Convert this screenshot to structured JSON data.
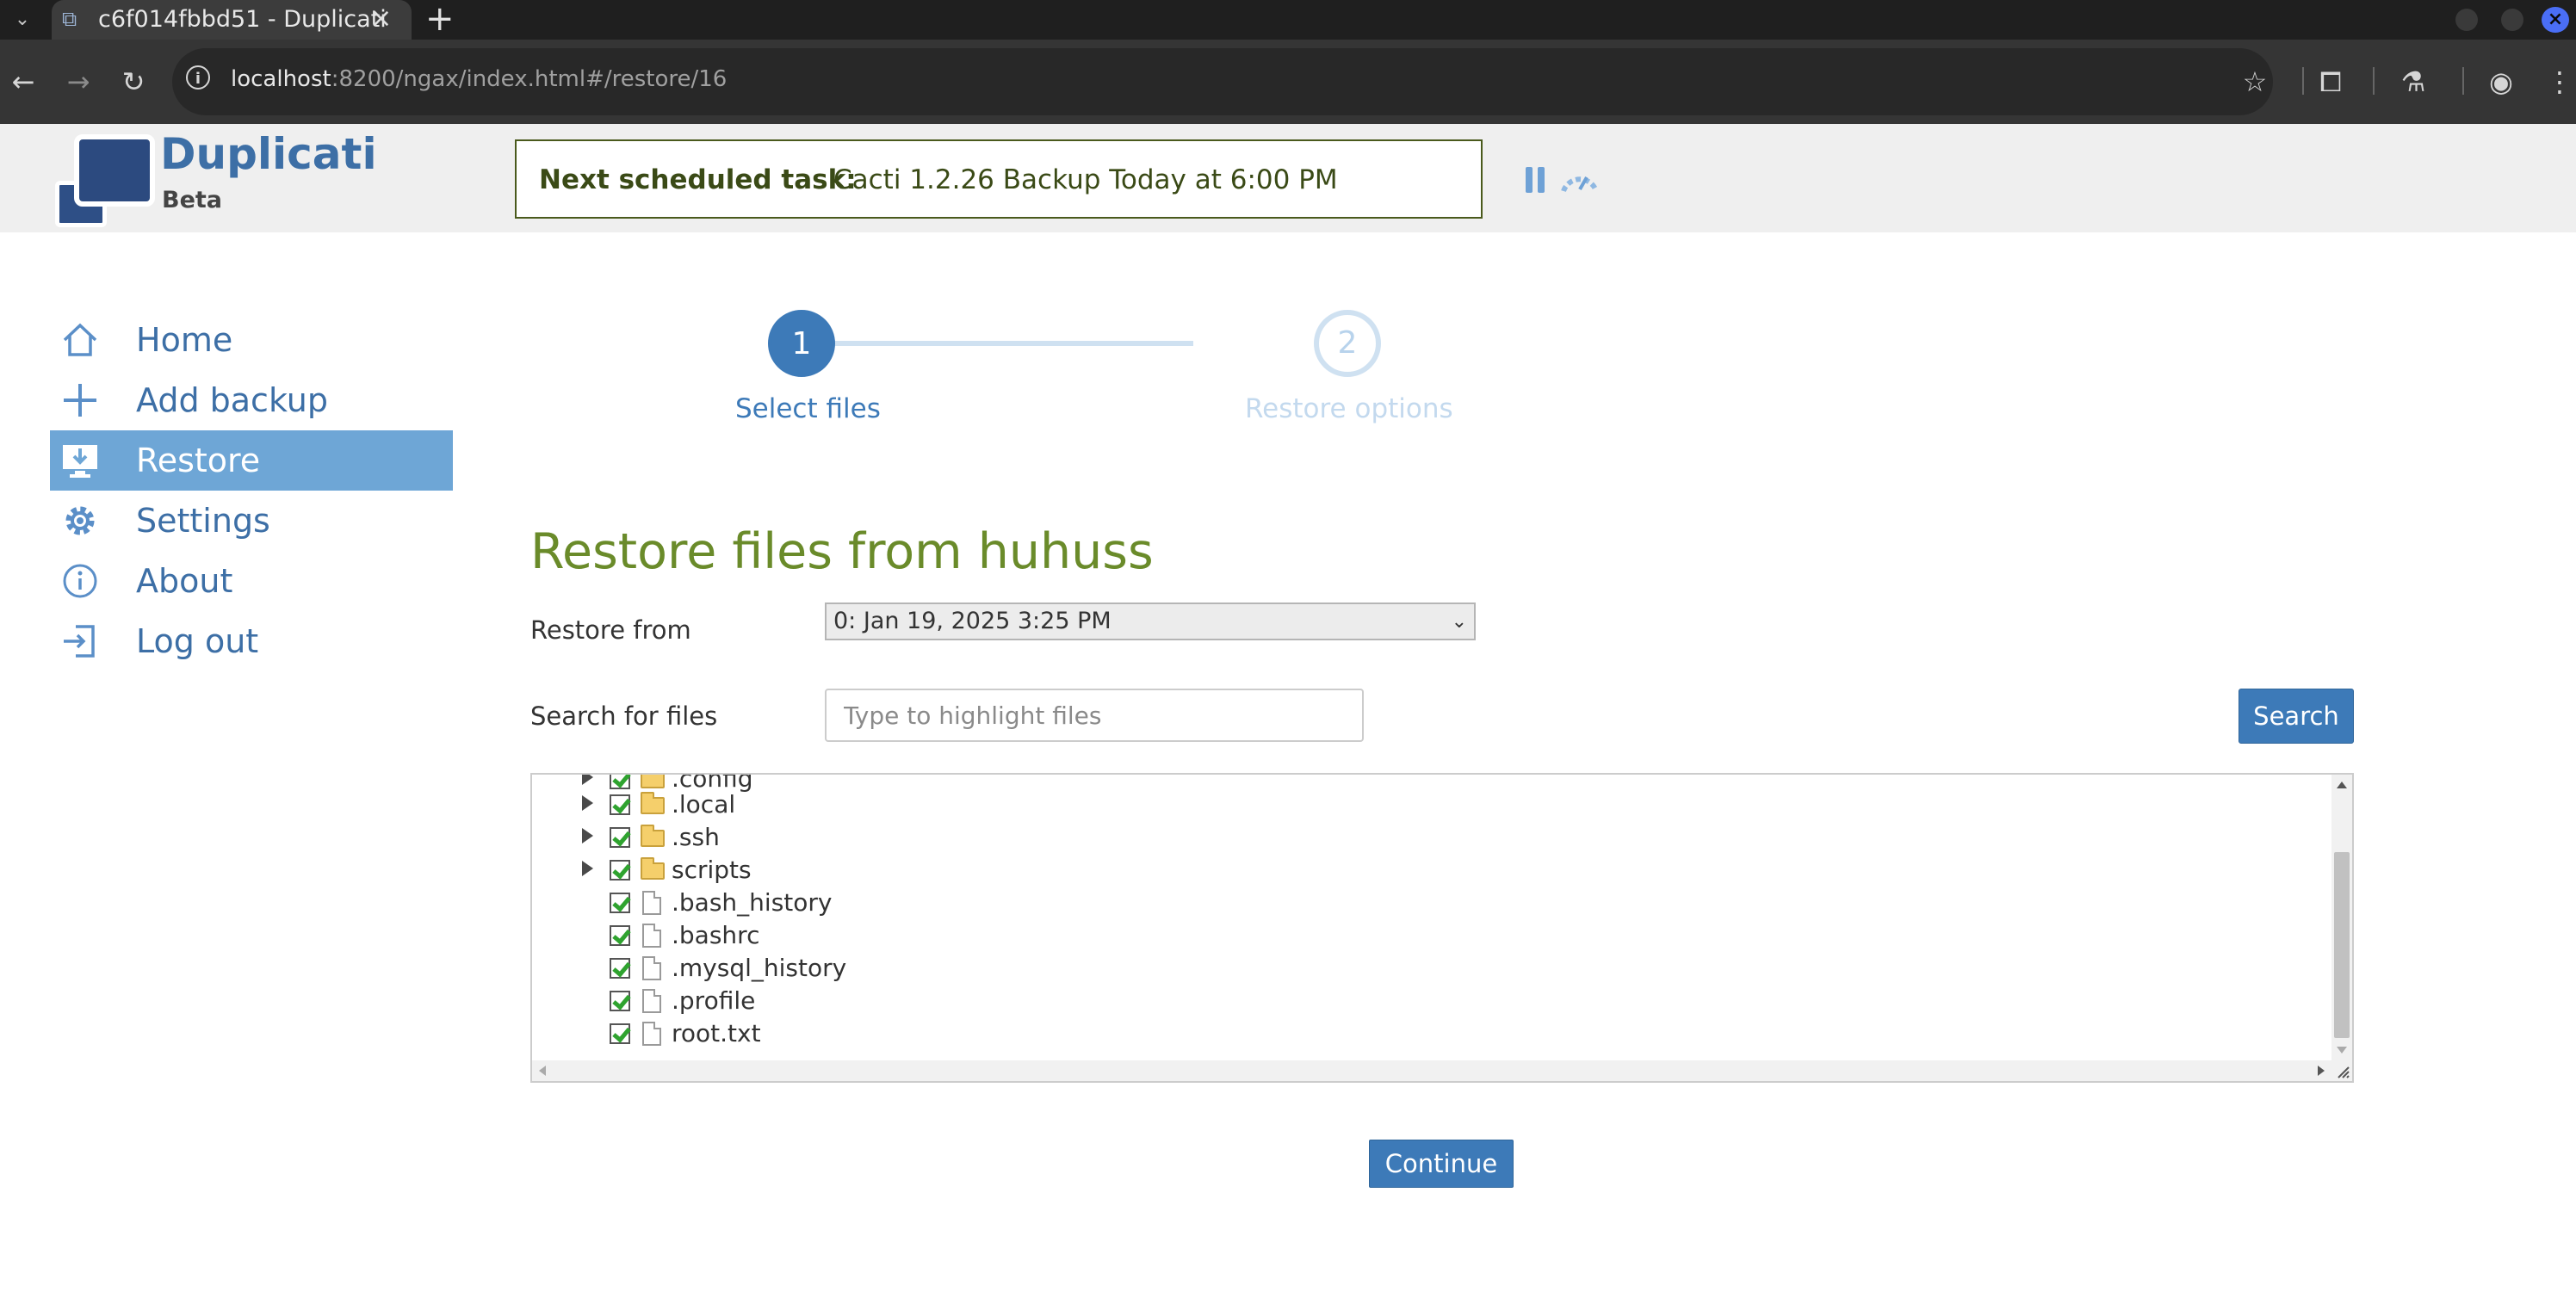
{
  "browser": {
    "tab_title": "c6f014fbbd51 - Duplicati",
    "url_host": "localhost",
    "url_path": ":8200/ngax/index.html#/restore/16"
  },
  "header": {
    "brand": "Duplicati",
    "brand_sub": "Beta",
    "next_task_label": "Next scheduled task:",
    "next_task_value": "Cacti 1.2.26 Backup Today at 6:00 PM"
  },
  "sidebar": {
    "items": [
      {
        "label": "Home",
        "icon": "home-icon"
      },
      {
        "label": "Add backup",
        "icon": "plus-icon"
      },
      {
        "label": "Restore",
        "icon": "restore-monitor-icon",
        "active": true
      },
      {
        "label": "Settings",
        "icon": "gear-icon"
      },
      {
        "label": "About",
        "icon": "info-icon"
      },
      {
        "label": "Log out",
        "icon": "logout-icon"
      }
    ]
  },
  "wizard": {
    "steps": [
      {
        "number": "1",
        "label": "Select files",
        "state": "current"
      },
      {
        "number": "2",
        "label": "Restore options",
        "state": "pending"
      }
    ]
  },
  "main": {
    "title": "Restore files from huhuss",
    "restore_from_label": "Restore from",
    "restore_from_value": "0: Jan 19, 2025 3:25 PM",
    "search_label": "Search for files",
    "search_placeholder": "Type to highlight files",
    "search_button": "Search",
    "continue_button": "Continue"
  },
  "tree": {
    "items": [
      {
        "name": ".config",
        "type": "folder",
        "checked": true
      },
      {
        "name": ".local",
        "type": "folder",
        "checked": true
      },
      {
        "name": ".ssh",
        "type": "folder",
        "checked": true
      },
      {
        "name": "scripts",
        "type": "folder",
        "checked": true
      },
      {
        "name": ".bash_history",
        "type": "file",
        "checked": true
      },
      {
        "name": ".bashrc",
        "type": "file",
        "checked": true
      },
      {
        "name": ".mysql_history",
        "type": "file",
        "checked": true
      },
      {
        "name": ".profile",
        "type": "file",
        "checked": true
      },
      {
        "name": "root.txt",
        "type": "file",
        "checked": true
      }
    ]
  },
  "colors": {
    "accent": "#3d7ab8",
    "title_green": "#6a8b2a",
    "sidebar_active": "#6ea6d6",
    "task_border": "#4a5a1c"
  }
}
